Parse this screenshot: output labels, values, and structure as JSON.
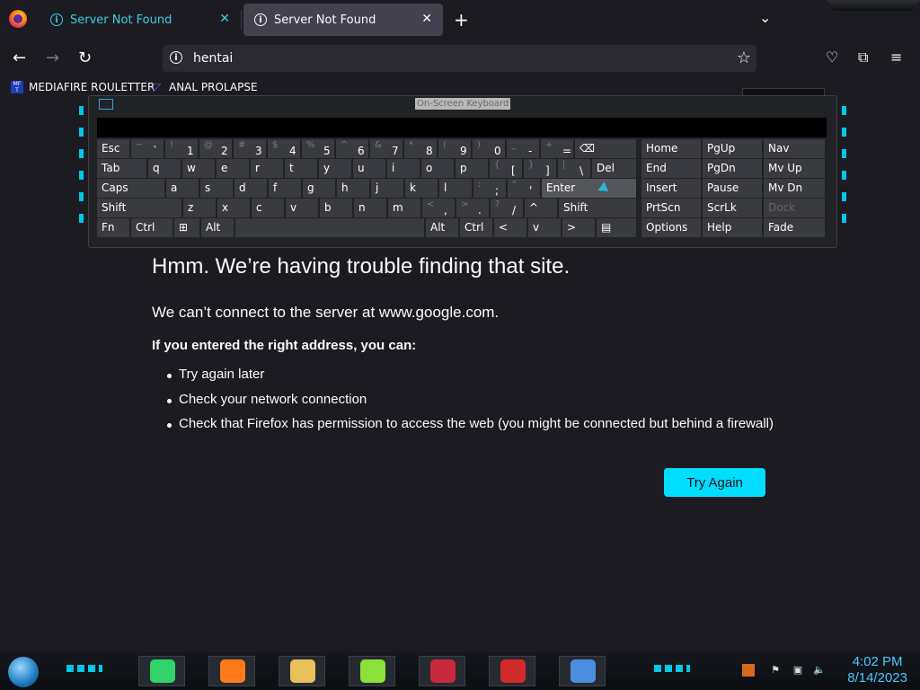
{
  "browser": {
    "tabs": [
      {
        "title": "Server Not Found",
        "active": false
      },
      {
        "title": "Server Not Found",
        "active": true
      }
    ],
    "url": "hentai",
    "bookmarks": [
      {
        "label": "MEDIAFIRE ROULETTER",
        "icon_text": "MF\nT"
      },
      {
        "label": "ANAL PROLAPSE"
      }
    ],
    "colors": {
      "accent": "#00ddff",
      "bg": "#1c1b22",
      "tab_text": "#3ad1e3"
    }
  },
  "error_page": {
    "title": "Hmm. We’re having trouble finding that site.",
    "description": "We can’t connect to the server at www.google.com.",
    "intro": "If you entered the right address, you can:",
    "suggestions": [
      "Try again later",
      "Check your network connection",
      "Check that Firefox has permission to access the web (you might be connected but behind a firewall)"
    ],
    "button": "Try Again"
  },
  "osk": {
    "title": "On-Screen Keyboard",
    "rows": [
      [
        {
          "l": "Esc"
        },
        {
          "s": "~",
          "c": "`"
        },
        {
          "s": "!",
          "c": "1"
        },
        {
          "s": "@",
          "c": "2"
        },
        {
          "s": "#",
          "c": "3"
        },
        {
          "s": "$",
          "c": "4"
        },
        {
          "s": "%",
          "c": "5"
        },
        {
          "s": "^",
          "c": "6"
        },
        {
          "s": "&",
          "c": "7"
        },
        {
          "s": "*",
          "c": "8"
        },
        {
          "s": "(",
          "c": "9"
        },
        {
          "s": ")",
          "c": "0"
        },
        {
          "s": "_",
          "c": "-"
        },
        {
          "s": "+",
          "c": "="
        },
        {
          "l": "⌫"
        }
      ],
      [
        {
          "l": "Tab"
        },
        {
          "l": "q"
        },
        {
          "l": "w"
        },
        {
          "l": "e"
        },
        {
          "l": "r"
        },
        {
          "l": "t"
        },
        {
          "l": "y"
        },
        {
          "l": "u"
        },
        {
          "l": "i"
        },
        {
          "l": "o"
        },
        {
          "l": "p"
        },
        {
          "s": "{",
          "c": "["
        },
        {
          "s": "}",
          "c": "]"
        },
        {
          "s": "|",
          "c": "\\"
        },
        {
          "l": "Del"
        }
      ],
      [
        {
          "l": "Caps"
        },
        {
          "l": "a"
        },
        {
          "l": "s"
        },
        {
          "l": "d"
        },
        {
          "l": "f"
        },
        {
          "l": "g"
        },
        {
          "l": "h"
        },
        {
          "l": "j"
        },
        {
          "l": "k"
        },
        {
          "l": "l"
        },
        {
          "s": ":",
          "c": ";"
        },
        {
          "s": "\"",
          "c": "'"
        },
        {
          "l": "Enter"
        }
      ],
      [
        {
          "l": "Shift"
        },
        {
          "l": "z"
        },
        {
          "l": "x"
        },
        {
          "l": "c"
        },
        {
          "l": "v"
        },
        {
          "l": "b"
        },
        {
          "l": "n"
        },
        {
          "l": "m"
        },
        {
          "s": "<",
          "c": ","
        },
        {
          "s": ">",
          "c": "."
        },
        {
          "s": "?",
          "c": "/"
        },
        {
          "l": "^"
        },
        {
          "l": "Shift"
        }
      ],
      [
        {
          "l": "Fn"
        },
        {
          "l": "Ctrl"
        },
        {
          "l": "⊞"
        },
        {
          "l": "Alt"
        },
        {
          "l": ""
        },
        {
          "l": "Alt"
        },
        {
          "l": "Ctrl"
        },
        {
          "l": "<"
        },
        {
          "l": "v"
        },
        {
          "l": ">"
        },
        {
          "l": "▤"
        }
      ]
    ],
    "nav_keys": [
      [
        "Home",
        "PgUp",
        "Nav"
      ],
      [
        "End",
        "PgDn",
        "Mv Up"
      ],
      [
        "Insert",
        "Pause",
        "Mv Dn"
      ],
      [
        "PrtScn",
        "ScrLk",
        "Dock"
      ],
      [
        "Options",
        "Help",
        "Fade"
      ]
    ]
  },
  "taskbar": {
    "time": "4:02 PM",
    "date": "8/14/2023",
    "apps": [
      "notes-app-icon",
      "firefox-icon",
      "file-explorer-icon",
      "lime-app-icon",
      "monitor-app-icon",
      "red-app-icon",
      "network-app-icon"
    ]
  }
}
